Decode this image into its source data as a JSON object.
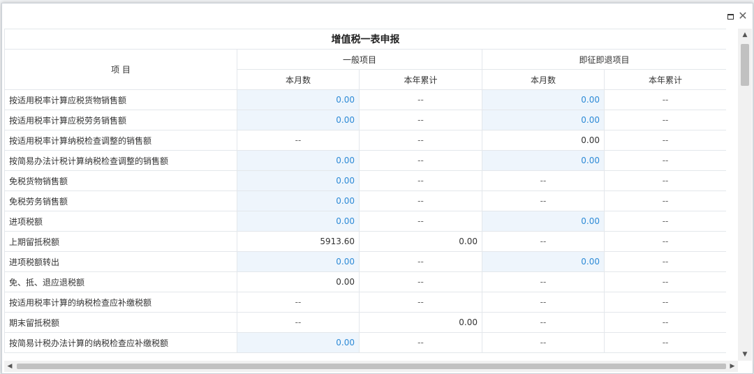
{
  "window": {
    "maximize_icon": "maximize-icon",
    "close_glyph": "✕"
  },
  "table": {
    "title": "增值税一表申报",
    "col_item": "项 目",
    "group_general": "一般项目",
    "group_refund": "即征即退项目",
    "sub_month": "本月数",
    "sub_year": "本年累计",
    "rows": [
      {
        "name": "按适用税率计算应税货物销售额",
        "g_month": "0.00",
        "g_year": "--",
        "r_month": "0.00",
        "r_year": "--"
      },
      {
        "name": "按适用税率计算应税劳务销售额",
        "g_month": "0.00",
        "g_year": "--",
        "r_month": "0.00",
        "r_year": "--"
      },
      {
        "name": "按适用税率计算纳税检查调整的销售额",
        "g_month": "--",
        "g_year": "--",
        "r_month": "0.00",
        "r_year": "--"
      },
      {
        "name": "按简易办法计税计算纳税检查调整的销售额",
        "g_month": "0.00",
        "g_year": "--",
        "r_month": "0.00",
        "r_year": "--"
      },
      {
        "name": "免税货物销售额",
        "g_month": "0.00",
        "g_year": "--",
        "r_month": "--",
        "r_year": "--"
      },
      {
        "name": "免税劳务销售额",
        "g_month": "0.00",
        "g_year": "--",
        "r_month": "--",
        "r_year": "--"
      },
      {
        "name": "进项税额",
        "g_month": "0.00",
        "g_year": "--",
        "r_month": "0.00",
        "r_year": "--"
      },
      {
        "name": "上期留抵税额",
        "g_month": "5913.60",
        "g_year": "0.00",
        "r_month": "--",
        "r_year": "--"
      },
      {
        "name": "进项税额转出",
        "g_month": "0.00",
        "g_year": "--",
        "r_month": "0.00",
        "r_year": "--"
      },
      {
        "name": "免、抵、退应退税额",
        "g_month": "0.00",
        "g_year": "--",
        "r_month": "--",
        "r_year": "--"
      },
      {
        "name": "按适用税率计算的纳税检查应补缴税额",
        "g_month": "--",
        "g_year": "--",
        "r_month": "--",
        "r_year": "--"
      },
      {
        "name": "期末留抵税额",
        "g_month": "--",
        "g_year": "0.00",
        "r_month": "--",
        "r_year": "--"
      },
      {
        "name": "按简易计税办法计算的纳税检查应补缴税额",
        "g_month": "0.00",
        "g_year": "--",
        "r_month": "--",
        "r_year": "--"
      }
    ]
  },
  "scroll": {
    "up_glyph": "▲",
    "down_glyph": "▼",
    "left_glyph": "◀",
    "right_glyph": "▶"
  }
}
